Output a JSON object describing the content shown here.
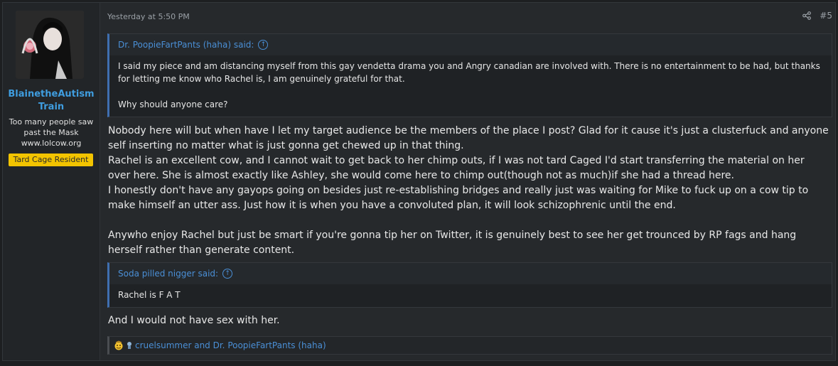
{
  "user": {
    "name": "BlainetheAutism Train",
    "title_lines": [
      "Too many people saw",
      "past the Mask",
      "www.lolcow.org"
    ],
    "badge": "Tard Cage Resident"
  },
  "post": {
    "timestamp": "Yesterday at 5:50 PM",
    "number": "#5"
  },
  "quote1": {
    "author": "Dr. PoopieFartPants (haha) said:",
    "paragraph1": "I said my piece and am distancing myself from this gay vendetta drama you and Angry canadian are involved with. There is no entertainment to be had, but thanks for letting me know who Rachel is, I am genuinely grateful for that.",
    "paragraph2": "Why should anyone care?"
  },
  "message1": {
    "lines": [
      "Nobody here will but when have I let my target audience be the members of the place I post? Glad for it cause it's just a clusterfuck and anyone self inserting no matter what is just gonna get chewed up in that thing.",
      "Rachel is an excellent cow, and I cannot wait to get back to her chimp outs, if I was not tard Caged I'd start transferring the material on her over here. She is almost exactly like Ashley, she would come here to chimp out(though not as much)if she had a thread here.",
      "I honestly don't have any gayops going on besides just re-establishing bridges and really just was waiting for Mike to fuck up on a cow tip to make himself an utter ass. Just how it is when you have a convoluted plan, it will look schizophrenic until the end."
    ],
    "closing": "Anywho enjoy Rachel but just be smart if you're gonna tip her on Twitter, it is genuinely best to see her get trounced by RP fags and hang herself rather than generate content."
  },
  "quote2": {
    "author": "Soda pilled nigger said:",
    "text": "Rachel is F A T"
  },
  "message2": "And I would not have sex with her.",
  "reactions": {
    "text": "cruelsummer and Dr. PoopieFartPants (haha)"
  },
  "colors": {
    "accent": "#3f9ddf",
    "badge": "#f3c400",
    "quote_border": "#3f6fb0"
  }
}
